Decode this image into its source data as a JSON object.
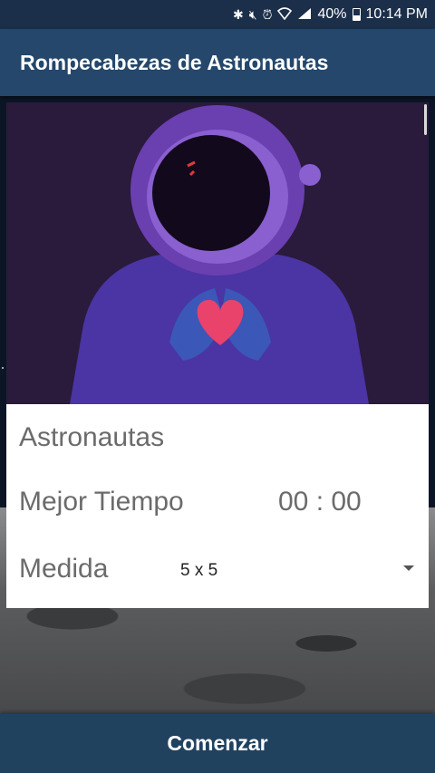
{
  "status_bar": {
    "battery_percent": "40%",
    "time": "10:14 PM",
    "icons": [
      "bluetooth-icon",
      "mute-icon",
      "alarm-icon",
      "wifi-icon",
      "signal-icon",
      "battery-icon"
    ]
  },
  "app_bar": {
    "title": "Rompecabezas de Astronautas"
  },
  "puzzle": {
    "image_name": "astronaut-heart-image",
    "name": "Astronautas",
    "best_time_label": "Mejor Tiempo",
    "best_time_value": "00 : 00",
    "size_label": "Medida",
    "size_value": "5 x 5"
  },
  "start_button": {
    "label": "Comenzar"
  },
  "colors": {
    "status_bar": "#1b2f4a",
    "app_bar": "#24476b",
    "button": "#21425f",
    "helmet": "#6a3fb0",
    "heart": "#e9426b"
  }
}
